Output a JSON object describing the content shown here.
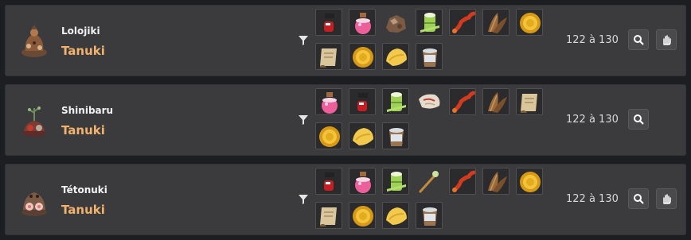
{
  "rows": [
    {
      "name": "Lolojiki",
      "family": "Tanuki",
      "level": "122 à 130",
      "has_hand_button": true,
      "avatar_icon": "tanuki-monster-brown",
      "items": [
        "potion-red-black",
        "potion-pink",
        "rock-lump",
        "bamboo-bundle",
        "red-sausage-string",
        "brown-feathers",
        "gold-coin",
        "scroll-paper",
        "gold-coin",
        "golden-cheese",
        "wooden-bucket"
      ]
    },
    {
      "name": "Shinibaru",
      "family": "Tanuki",
      "level": "122 à 130",
      "has_hand_button": false,
      "avatar_icon": "tanuki-monster-red",
      "items": [
        "potion-pink",
        "potion-red-black",
        "bamboo-bundle",
        "cloth-bundle",
        "red-sausage-string",
        "brown-feathers",
        "scroll-paper",
        "gold-coin",
        "golden-cheese",
        "wooden-bucket"
      ]
    },
    {
      "name": "Tétonuki",
      "family": "Tanuki",
      "level": "122 à 130",
      "has_hand_button": true,
      "avatar_icon": "tanuki-monster-pink",
      "items": [
        "potion-red-black",
        "potion-pink",
        "bamboo-bundle",
        "wand-stick",
        "red-sausage-string",
        "brown-feathers",
        "gold-coin",
        "scroll-paper",
        "gold-coin",
        "golden-cheese",
        "wooden-bucket"
      ]
    }
  ],
  "icons": {
    "filter": "filter-funnel-icon",
    "search": "magnifier-icon",
    "hand": "hand-icon"
  }
}
